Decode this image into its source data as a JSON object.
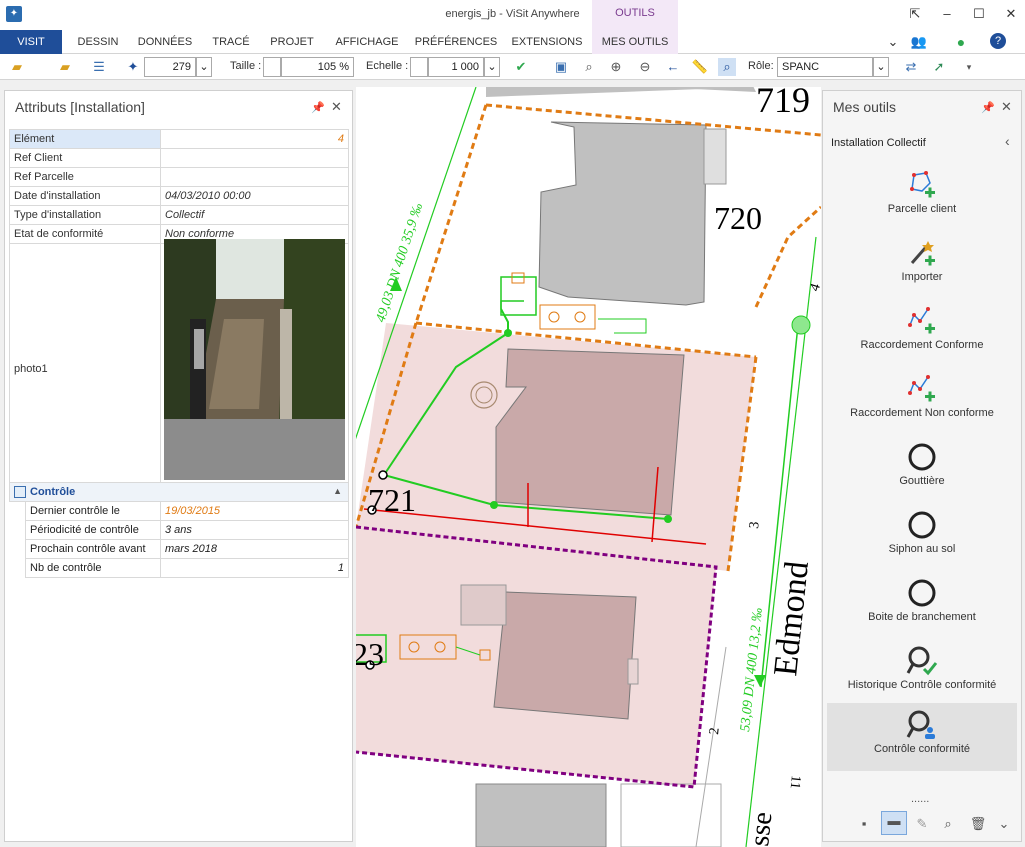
{
  "window": {
    "title": "energis_jb - ViSit Anywhere",
    "contextual_tab": "OUTILS"
  },
  "ribbon": {
    "tabs": [
      "VISIT",
      "DESSIN",
      "DONNÉES",
      "TRACÉ",
      "PROJET",
      "AFFICHAGE",
      "PRÉFÉRENCES",
      "EXTENSIONS",
      "MES OUTILS"
    ]
  },
  "toolbar": {
    "element_count": "279",
    "taille_label": "Taille :",
    "taille_value": "105 %",
    "echelle_label": "Echelle :",
    "echelle_value": "1 000",
    "role_label": "Rôle:",
    "role_value": "SPANC"
  },
  "attributes": {
    "title": "Attributs [Installation]",
    "rows": [
      {
        "key": "Elément",
        "value": "4"
      },
      {
        "key": "Ref Client",
        "value": ""
      },
      {
        "key": "Ref Parcelle",
        "value": ""
      },
      {
        "key": "Date d'installation",
        "value": "04/03/2010 00:00"
      },
      {
        "key": "Type d'installation",
        "value": "Collectif"
      },
      {
        "key": "Etat de conformité",
        "value": "Non conforme"
      }
    ],
    "photo_label": "photo1",
    "controle": {
      "title": "Contrôle",
      "rows": [
        {
          "key": "Dernier contrôle le",
          "value": "19/03/2015"
        },
        {
          "key": "Périodicité de contrôle",
          "value": "3 ans"
        },
        {
          "key": "Prochain contrôle avant",
          "value": "mars 2018"
        },
        {
          "key": "Nb de contrôle",
          "value": "1"
        }
      ]
    }
  },
  "map": {
    "labels": {
      "parcel_719": "719",
      "parcel_720": "720",
      "parcel_721": "721",
      "parcel_723": "23",
      "street": "Edmond",
      "street2": "sse",
      "pipe1": "49,03 DN 400 35,9 ‰",
      "pipe2": "53,09 DN 400 13,2 ‰",
      "num_4": "4",
      "num_3": "3",
      "num_2": "2",
      "num_11": "11"
    }
  },
  "tools": {
    "title": "Mes outils",
    "section": "Installation Collectif",
    "items": [
      {
        "label": "Parcelle client",
        "icon": "parcel-add-icon"
      },
      {
        "label": "Importer",
        "icon": "wand-add-icon"
      },
      {
        "label": "Raccordement Conforme",
        "icon": "polyline-add-icon"
      },
      {
        "label": "Raccordement Non conforme",
        "icon": "polyline-add-icon"
      },
      {
        "label": "Gouttière",
        "icon": "ring-icon"
      },
      {
        "label": "Siphon au sol",
        "icon": "ring-icon"
      },
      {
        "label": "Boite de branchement",
        "icon": "ring-icon"
      },
      {
        "label": "Historique Contrôle conformité",
        "icon": "magnifier-check-icon"
      },
      {
        "label": "Contrôle conformité",
        "icon": "magnifier-user-icon"
      }
    ],
    "grip": "......"
  },
  "colors": {
    "accent": "#1f4e99",
    "orange": "#e07b14",
    "green": "#22cc22",
    "purple": "#800080",
    "parcel_fill": "#f2dcdc"
  }
}
